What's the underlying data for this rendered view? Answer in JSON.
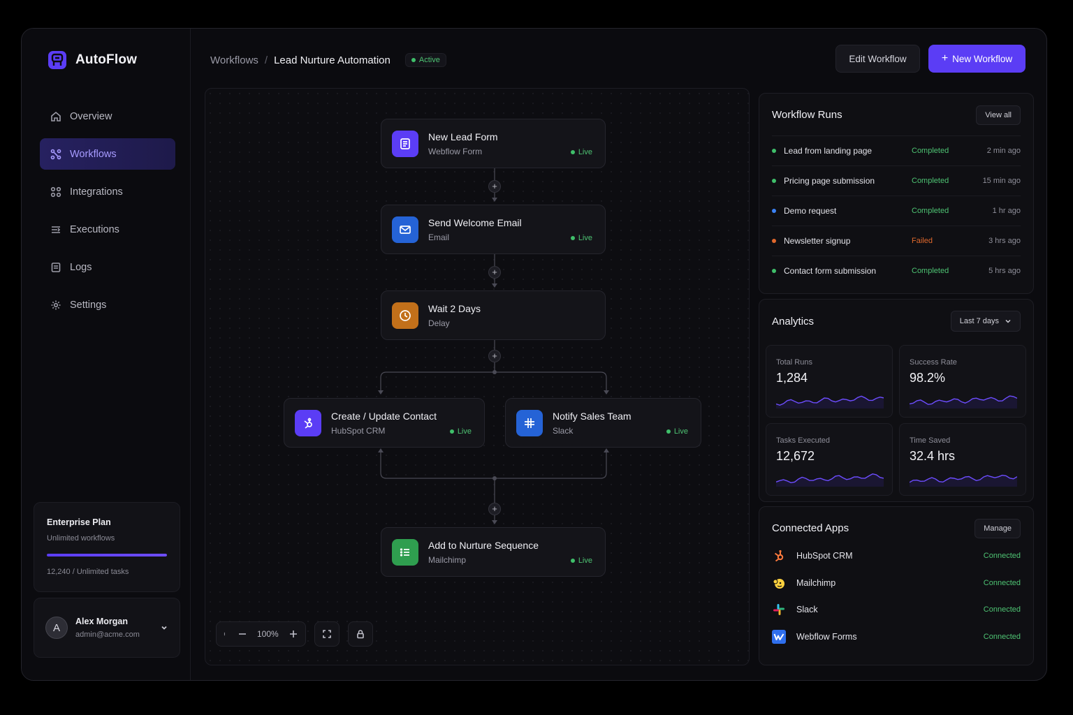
{
  "app": {
    "name": "AutoFlow",
    "brand_color": "#5b3df5"
  },
  "sidebar": {
    "items": [
      {
        "label": "Overview",
        "icon": "home-icon"
      },
      {
        "label": "Workflows",
        "icon": "workflow-icon",
        "active": true
      },
      {
        "label": "Integrations",
        "icon": "grid-icon"
      },
      {
        "label": "Executions",
        "icon": "executions-icon"
      },
      {
        "label": "Logs",
        "icon": "logs-icon"
      },
      {
        "label": "Settings",
        "icon": "gear-icon"
      }
    ],
    "plan": {
      "title": "Enterprise Plan",
      "subtitle": "Unlimited workflows",
      "usage": "12,240 / Unlimited tasks",
      "progress": 1.0
    },
    "user": {
      "initial": "A",
      "name": "Alex Morgan",
      "email": "admin@acme.com"
    }
  },
  "header": {
    "breadcrumb_root": "Workflows",
    "separator": "/",
    "title": "Lead Nurture Automation",
    "status": "Active",
    "edit_label": "Edit Workflow",
    "new_label": "New Workflow"
  },
  "canvas": {
    "nodes": [
      {
        "title": "New Lead Form",
        "subtitle": "Webflow Form",
        "status": "Live",
        "icon": "form-icon",
        "color": "#5b3df5"
      },
      {
        "title": "Send Welcome Email",
        "subtitle": "Email",
        "status": "Live",
        "icon": "mail-icon",
        "color": "#2563d6"
      },
      {
        "title": "Wait 2 Days",
        "subtitle": "Delay",
        "status": "",
        "icon": "clock-icon",
        "color": "#c2701a"
      },
      {
        "title": "Create / Update Contact",
        "subtitle": "HubSpot CRM",
        "status": "Live",
        "icon": "hubspot-icon",
        "color": "#5b3df5"
      },
      {
        "title": "Notify Sales Team",
        "subtitle": "Slack",
        "status": "Live",
        "icon": "slack-icon",
        "color": "#2563d6"
      },
      {
        "title": "Add to Nurture Sequence",
        "subtitle": "Mailchimp",
        "status": "Live",
        "icon": "list-icon",
        "color": "#2f9e4f"
      }
    ],
    "zoom": "100%"
  },
  "runs": {
    "title": "Workflow Runs",
    "view_all": "View all",
    "items": [
      {
        "name": "Lead from landing page",
        "status": "Completed",
        "time": "2 min ago",
        "dot": "#3fbf6a"
      },
      {
        "name": "Pricing page submission",
        "status": "Completed",
        "time": "15 min ago",
        "dot": "#3fbf6a"
      },
      {
        "name": "Demo request",
        "status": "Completed",
        "time": "1 hr ago",
        "dot": "#3b82f6"
      },
      {
        "name": "Newsletter signup",
        "status": "Failed",
        "time": "3 hrs ago",
        "dot": "#e0682c"
      },
      {
        "name": "Contact form submission",
        "status": "Completed",
        "time": "5 hrs ago",
        "dot": "#3fbf6a"
      }
    ]
  },
  "analytics": {
    "title": "Analytics",
    "range": "Last 7 days",
    "stats": [
      {
        "label": "Total Runs",
        "value": "1,284"
      },
      {
        "label": "Success Rate",
        "value": "98.2%"
      },
      {
        "label": "Tasks Executed",
        "value": "12,672"
      },
      {
        "label": "Time Saved",
        "value": "32.4 hrs"
      }
    ]
  },
  "apps": {
    "title": "Connected Apps",
    "manage": "Manage",
    "items": [
      {
        "name": "HubSpot CRM",
        "status": "Connected",
        "icon": "hubspot-logo-icon"
      },
      {
        "name": "Mailchimp",
        "status": "Connected",
        "icon": "mailchimp-logo-icon"
      },
      {
        "name": "Slack",
        "status": "Connected",
        "icon": "slack-logo-icon"
      },
      {
        "name": "Webflow Forms",
        "status": "Connected",
        "icon": "webflow-logo-icon"
      }
    ]
  },
  "colors": {
    "success": "#4ec373",
    "failed": "#e0682c",
    "accent": "#5b3df5"
  }
}
